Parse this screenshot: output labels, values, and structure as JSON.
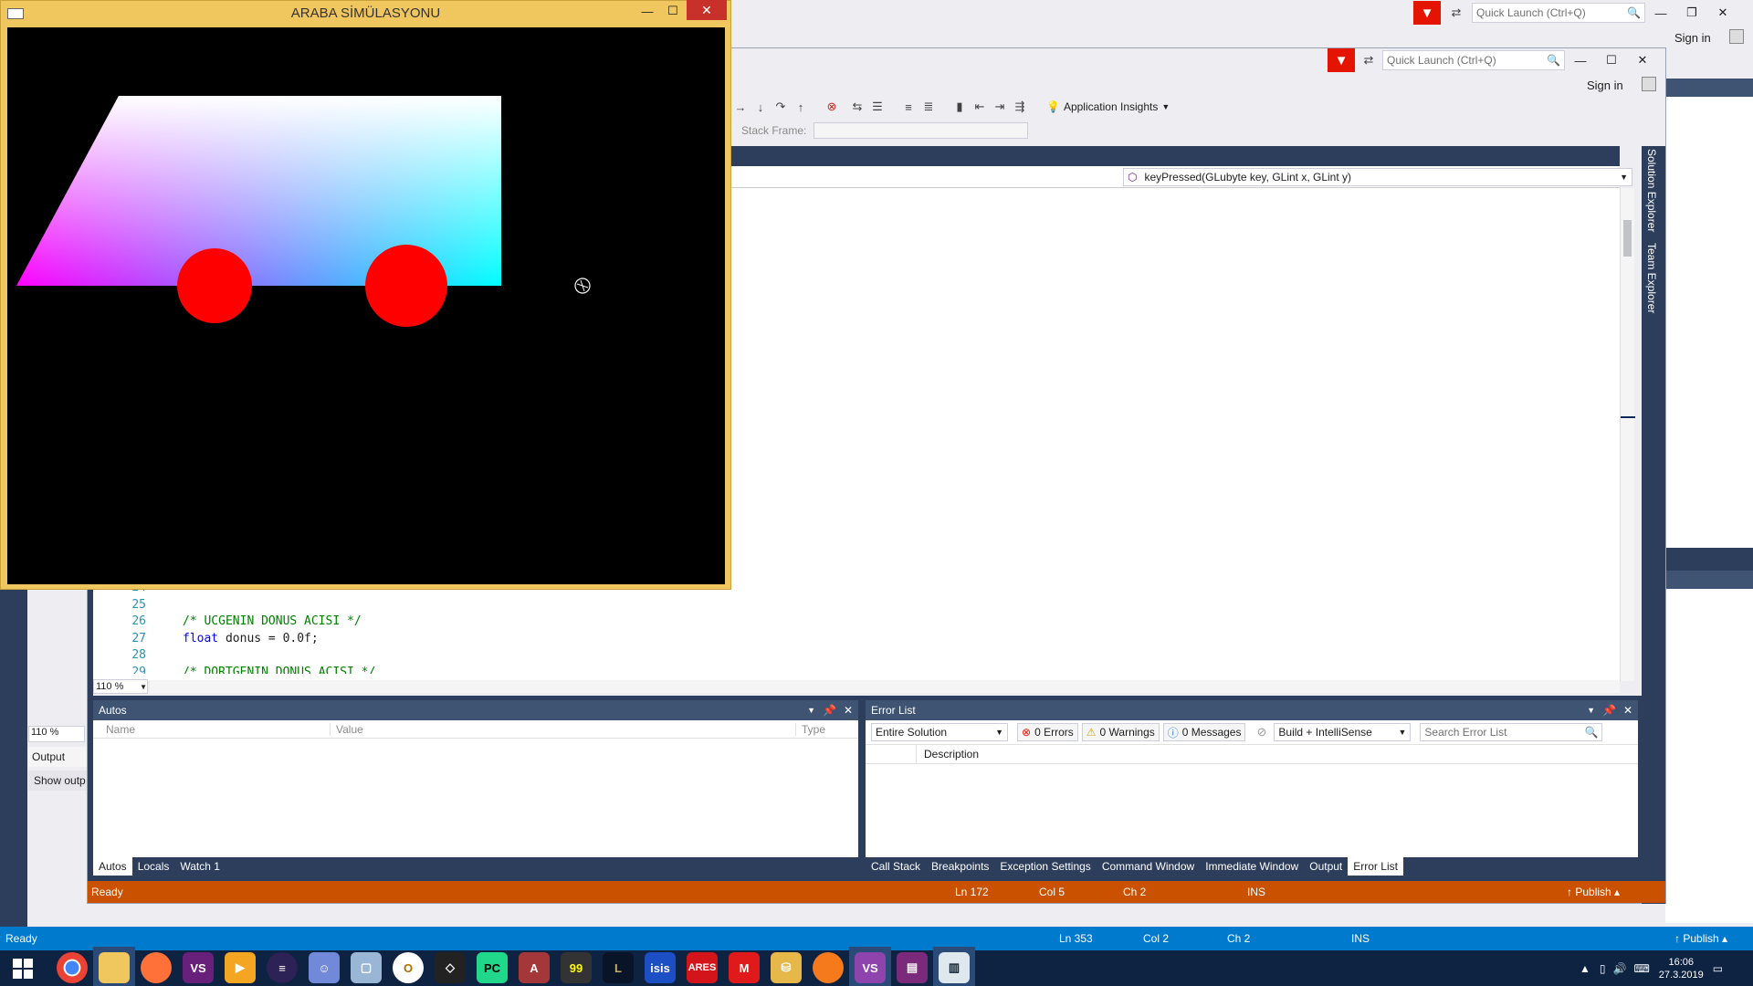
{
  "outer_vs": {
    "quick_launch_placeholder": "Quick Launch (Ctrl+Q)",
    "sign_in": "Sign in",
    "status": {
      "ready": "Ready",
      "ln": "Ln 353",
      "col": "Col 2",
      "ch": "Ch 2",
      "ins": "INS",
      "publish": "Publish"
    },
    "zoom": "110 %",
    "output_title": "Output",
    "show_output": "Show outp"
  },
  "inner_vs": {
    "quick_launch_placeholder": "Quick Launch (Ctrl+Q)",
    "sign_in": "Sign in",
    "toolbar": {
      "app_insights": "Application Insights",
      "stack_frame": "Stack Frame:"
    },
    "member_dropdown": "keyPressed(GLubyte key, GLint x, GLint y)",
    "side_tabs": [
      "Solution Explorer",
      "Team Explorer"
    ],
    "code_lines": [
      {
        "num": "24",
        "text": ""
      },
      {
        "num": "25",
        "text": ""
      },
      {
        "num": "26",
        "text": "/* UCGENIN DONUS ACISI */",
        "kind": "comment"
      },
      {
        "num": "27",
        "text_kw": "float",
        "text_rest": " donus = 0.0f;",
        "kind": "code"
      },
      {
        "num": "28",
        "text": ""
      },
      {
        "num": "29",
        "text": "/* DORTGENIN DONUS ACISI */",
        "kind": "comment"
      }
    ],
    "editor_zoom": "110 %",
    "autos": {
      "title": "Autos",
      "columns": [
        "Name",
        "Value",
        "Type"
      ],
      "tabs": [
        "Autos",
        "Locals",
        "Watch 1"
      ]
    },
    "error_list": {
      "title": "Error List",
      "scope": "Entire Solution",
      "errors": "0 Errors",
      "warnings": "0 Warnings",
      "messages": "0 Messages",
      "build_filter": "Build + IntelliSense",
      "search_placeholder": "Search Error List",
      "column_description": "Description",
      "tabs": [
        "Call Stack",
        "Breakpoints",
        "Exception Settings",
        "Command Window",
        "Immediate Window",
        "Output",
        "Error List"
      ]
    },
    "status": {
      "ready": "Ready",
      "ln": "Ln 172",
      "col": "Col 5",
      "ch": "Ch 2",
      "ins": "INS",
      "publish": "Publish"
    }
  },
  "sim_window": {
    "title": "ARABA SİMÜLASYONU",
    "colors": {
      "frame": "#f0c75e",
      "wheel": "#ff0000",
      "canvas": "#000000"
    }
  },
  "taskbar": {
    "apps": [
      "chrome-icon",
      "file-explorer-icon",
      "firefox-icon",
      "visual-studio-icon",
      "media-player-icon",
      "eclipse-icon",
      "discord-icon",
      "virtualbox-icon",
      "opera-icon",
      "unity-icon",
      "pycharm-icon",
      "access-icon",
      "terminal-icon",
      "league-icon",
      "isis-icon",
      "ares-icon",
      "microchip-icon",
      "database-icon",
      "firefox-dev-icon",
      "visual-studio-active-icon",
      "winrar-icon",
      "notepad-icon"
    ],
    "time": "16:06",
    "date": "27.3.2019"
  }
}
